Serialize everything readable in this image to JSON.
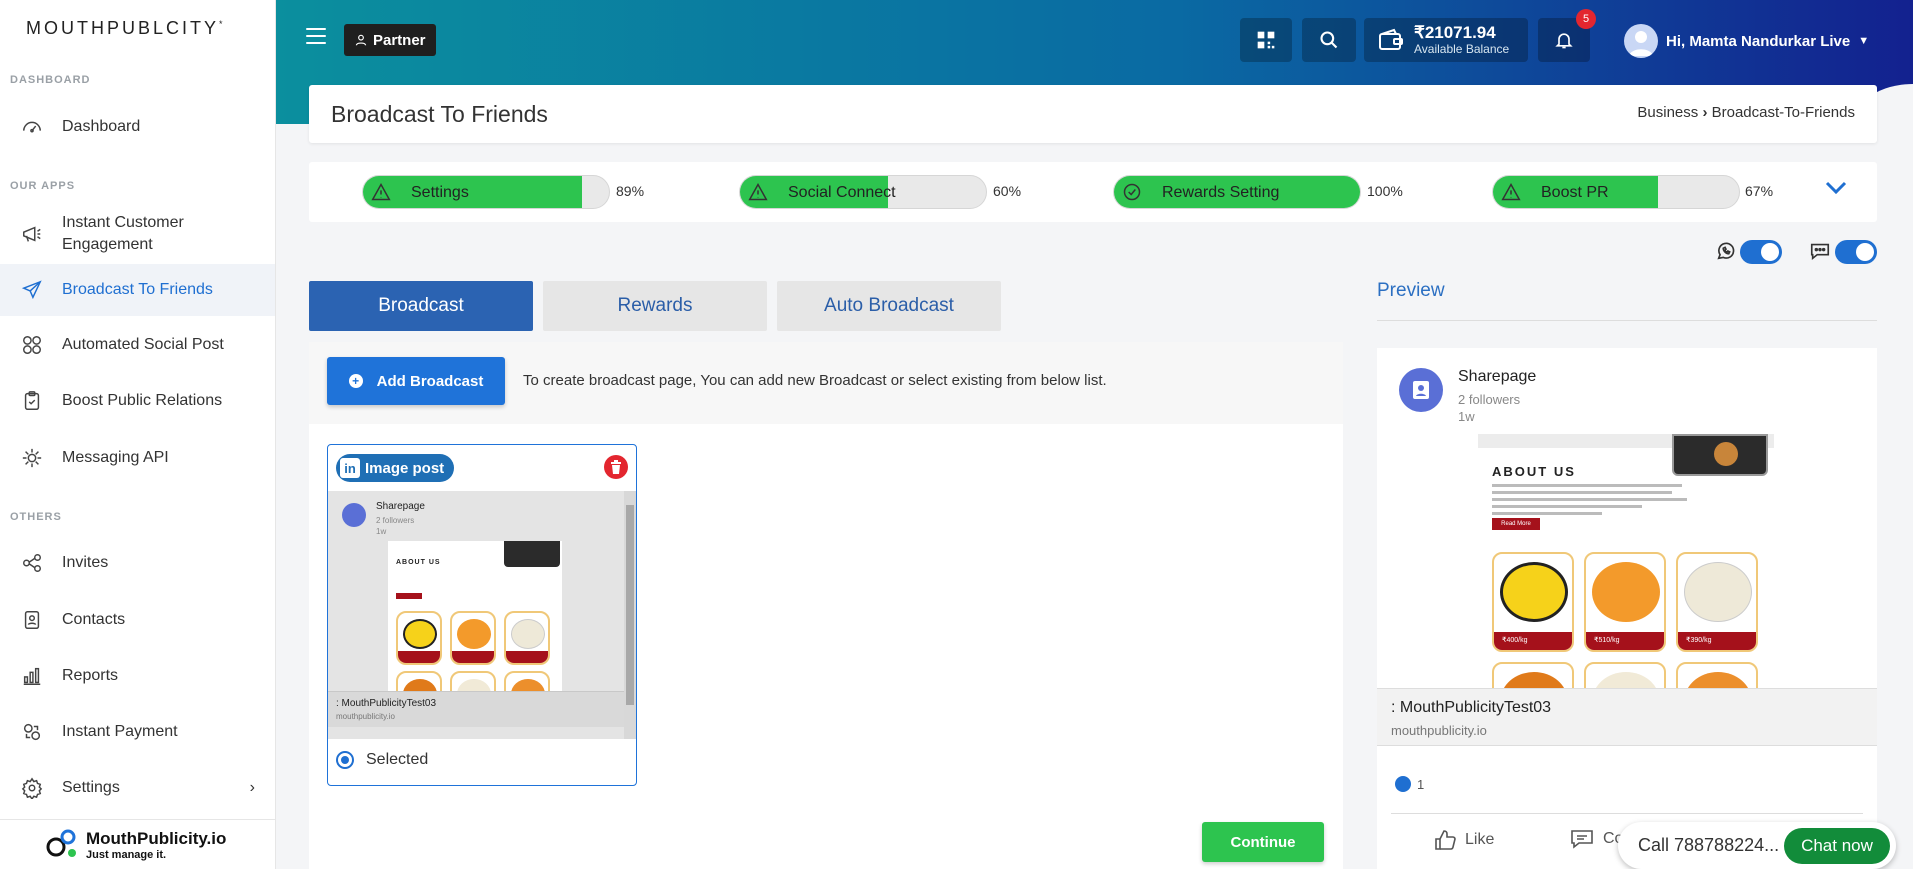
{
  "sidebar": {
    "brand": "MOUTHPUBLCITY",
    "brand_mark": "*",
    "sections": {
      "dashboard": "DASHBOARD",
      "apps": "OUR APPS",
      "others": "OTHERS"
    },
    "items": [
      {
        "label": "Dashboard",
        "icon": "gauge-icon"
      },
      {
        "label": "Instant Customer Engagement",
        "icon": "megaphone-icon"
      },
      {
        "label": "Broadcast To Friends",
        "icon": "paper-plane-icon",
        "active": true
      },
      {
        "label": "Automated Social Post",
        "icon": "social-circles-icon"
      },
      {
        "label": "Boost Public Relations",
        "icon": "clipboard-icon"
      },
      {
        "label": "Messaging API",
        "icon": "api-gear-icon"
      },
      {
        "label": "Invites",
        "icon": "share-icon"
      },
      {
        "label": "Contacts",
        "icon": "contact-card-icon"
      },
      {
        "label": "Reports",
        "icon": "bar-chart-icon"
      },
      {
        "label": "Instant Payment",
        "icon": "payment-icon"
      },
      {
        "label": "Settings",
        "icon": "gear-icon"
      }
    ],
    "footer_logo_name": "MouthPublicity.io",
    "footer_logo_tag": "Just manage it."
  },
  "header": {
    "partner_label": "Partner",
    "balance_amount": "₹21071.94",
    "balance_label": "Available Balance",
    "notification_count": "5",
    "user_greeting": "Hi, Mamta Nandurkar Live"
  },
  "page": {
    "title": "Broadcast To Friends",
    "breadcrumb_parent": "Business",
    "breadcrumb_current": "Broadcast-To-Friends"
  },
  "progress": [
    {
      "label": "Settings",
      "percent": 89,
      "percent_text": "89%",
      "status": "warning"
    },
    {
      "label": "Social Connect",
      "percent": 60,
      "percent_text": "60%",
      "status": "warning"
    },
    {
      "label": "Rewards Setting",
      "percent": 100,
      "percent_text": "100%",
      "status": "complete"
    },
    {
      "label": "Boost PR",
      "percent": 67,
      "percent_text": "67%",
      "status": "warning"
    }
  ],
  "tabs": {
    "broadcast": "Broadcast",
    "rewards": "Rewards",
    "auto_broadcast": "Auto Broadcast"
  },
  "broadcast": {
    "add_label": "Add Broadcast",
    "hint": "To create broadcast page, You can add new Broadcast or select existing from below list.",
    "post_type": "Image post",
    "selected_label": "Selected",
    "continue_label": "Continue"
  },
  "mini_post": {
    "name": "Sharepage",
    "followers": "2 followers",
    "time": "1w",
    "about": "ABOUT US",
    "footer_title": ": MouthPublicityTest03",
    "footer_url": "mouthpublicity.io"
  },
  "preview": {
    "title": "Preview",
    "name": "Sharepage",
    "followers": "2 followers",
    "time": "1w",
    "about": "ABOUT US",
    "read_more": "Read More",
    "prices": [
      "₹400/kg",
      "₹510/kg",
      "₹390/kg"
    ],
    "footer_title": ": MouthPublicityTest03",
    "footer_url": "mouthpublicity.io",
    "reactions": "1",
    "like_label": "Like",
    "comment_label": "Co"
  },
  "chat": {
    "call_text": "Call 788788224...",
    "button_label": "Chat now"
  },
  "colors": {
    "accent": "#1f6fd1",
    "success": "#2dc44f",
    "danger": "#e3262f",
    "tab_active": "#2b63b2"
  }
}
